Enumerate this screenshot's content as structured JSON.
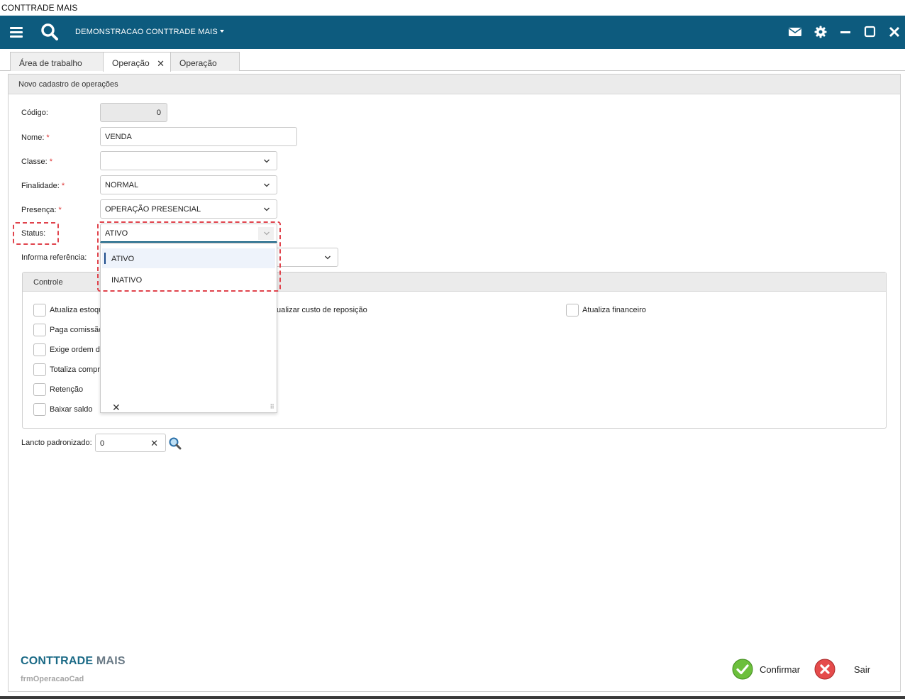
{
  "app": {
    "window_title": "CONTTRADE MAIS"
  },
  "topbar": {
    "company": "DEMONSTRACAO CONTTRADE MAIS",
    "icons": [
      "menu-icon",
      "search-icon",
      "mail-icon",
      "gear-icon",
      "minimize-icon",
      "maximize-icon",
      "close-icon"
    ],
    "bg_color": "#0d5b7e"
  },
  "tabs": [
    {
      "label": "Área de trabalho"
    },
    {
      "label": "Operação",
      "active": true,
      "closable": true
    },
    {
      "label": "Operação"
    }
  ],
  "form": {
    "header": "Novo cadastro de operações",
    "fields": {
      "codigo": {
        "label": "Código:",
        "value": "0"
      },
      "nome": {
        "label": "Nome:",
        "value": "VENDA",
        "required": "*"
      },
      "classe": {
        "label": "Classe:",
        "value": "",
        "required": "*"
      },
      "finalidade": {
        "label": "Finalidade:",
        "value": "NORMAL",
        "required": "*"
      },
      "presenca": {
        "label": "Presença:",
        "value": "OPERAÇÃO PRESENCIAL",
        "required": "*"
      },
      "status": {
        "label": "Status:",
        "value": "ATIVO",
        "options": [
          "ATIVO",
          "INATIVO"
        ]
      },
      "informa_referencia": {
        "label": "Informa referência:"
      }
    },
    "controle": {
      "title": "Controle",
      "checkboxes_left": [
        "Atualiza estoque",
        "Paga comissão",
        "Exige ordem de",
        "Totaliza compra",
        "Retenção",
        "Baixar saldo"
      ],
      "checkbox_mid": "ualizar custo de reposição",
      "checkbox_right": "Atualiza financeiro"
    },
    "lancto": {
      "label": "Lancto padronizado:",
      "value": "0"
    }
  },
  "footer": {
    "brand_main": "CONTTRADE",
    "brand_suffix": "MAIS",
    "form_name": "frmOperacaoCad",
    "confirm_label": "Confirmar",
    "exit_label": "Sair"
  },
  "highlight_color": "#e0434c"
}
